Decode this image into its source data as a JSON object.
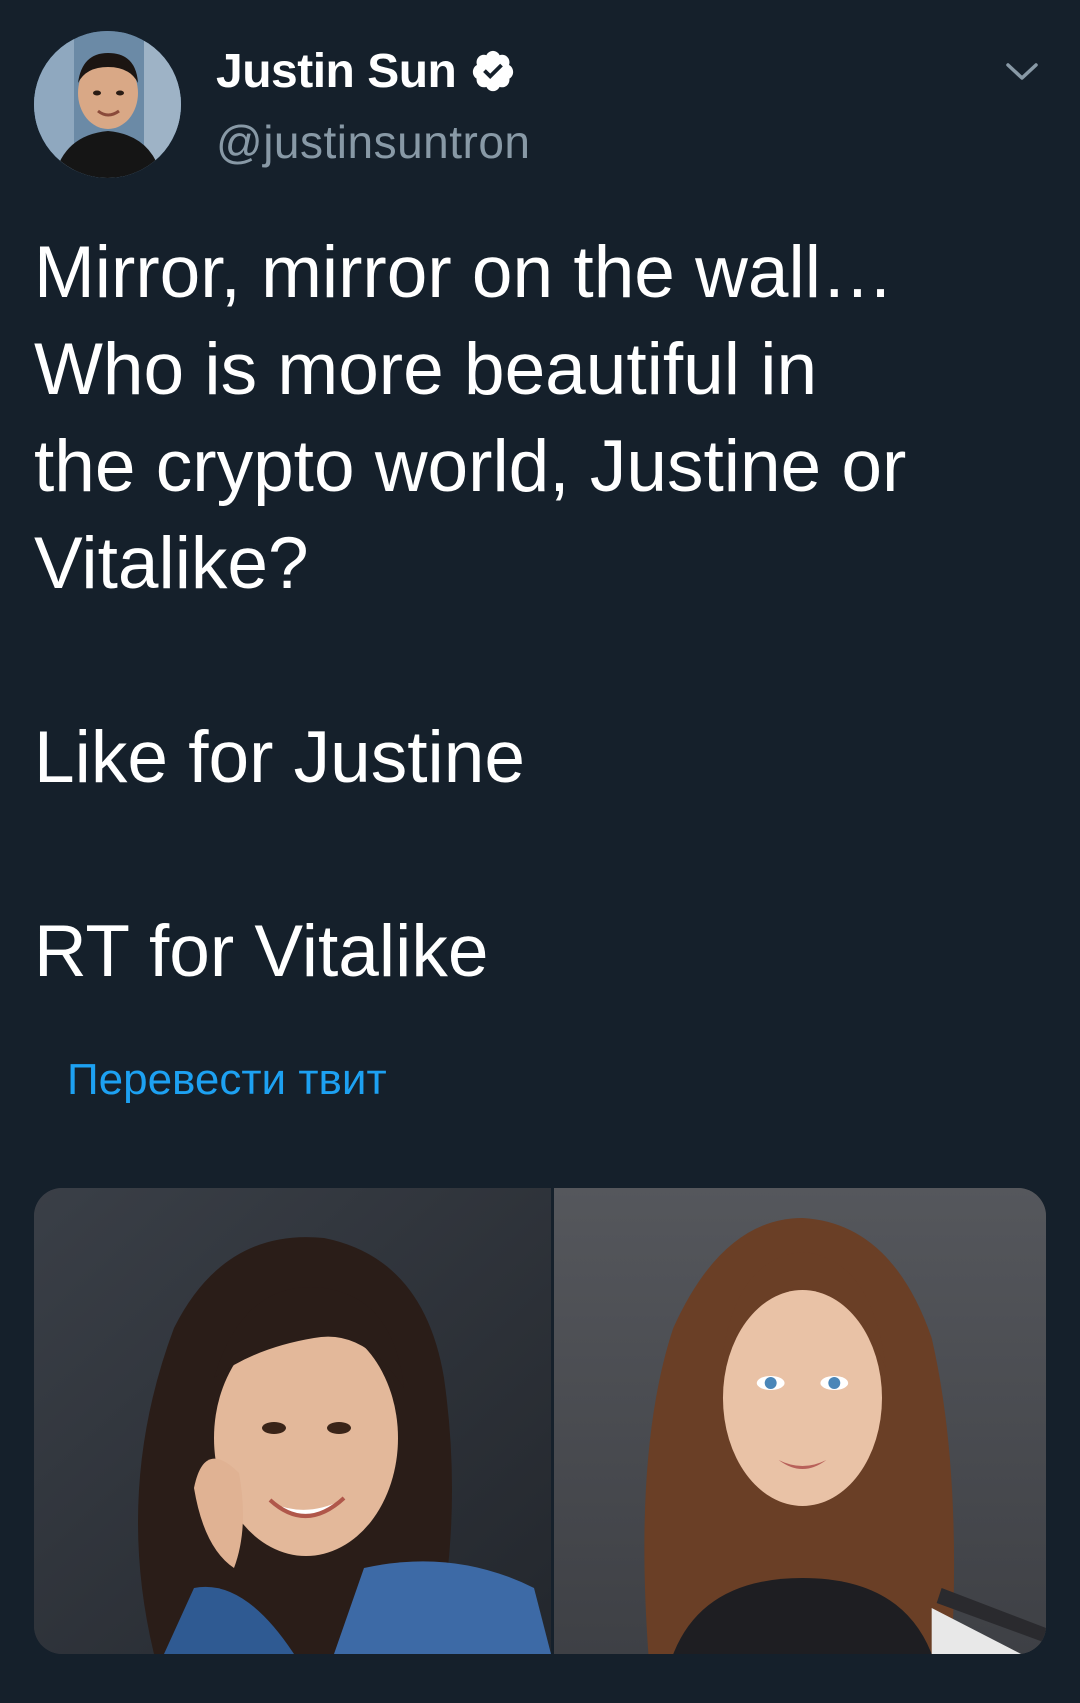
{
  "author": {
    "display_name": "Justin Sun",
    "handle": "@justinsuntron",
    "verified": true,
    "avatar_icon": "profile-photo-icon"
  },
  "tweet": {
    "lines": [
      "Mirror, mirror on the wall…",
      "Who is more beautiful in",
      "the crypto world, Justine or",
      "Vitalike?"
    ],
    "line_like": "Like for Justine",
    "line_rt": "RT for Vitalike"
  },
  "translate_label": "Перевести твит",
  "colors": {
    "background": "#15202b",
    "text": "#ffffff",
    "secondary": "#8899a6",
    "accent": "#1da1f2"
  },
  "media": [
    {
      "icon": "woman-portrait-dark-hair-photo"
    },
    {
      "icon": "woman-portrait-long-brown-hair-photo"
    }
  ]
}
